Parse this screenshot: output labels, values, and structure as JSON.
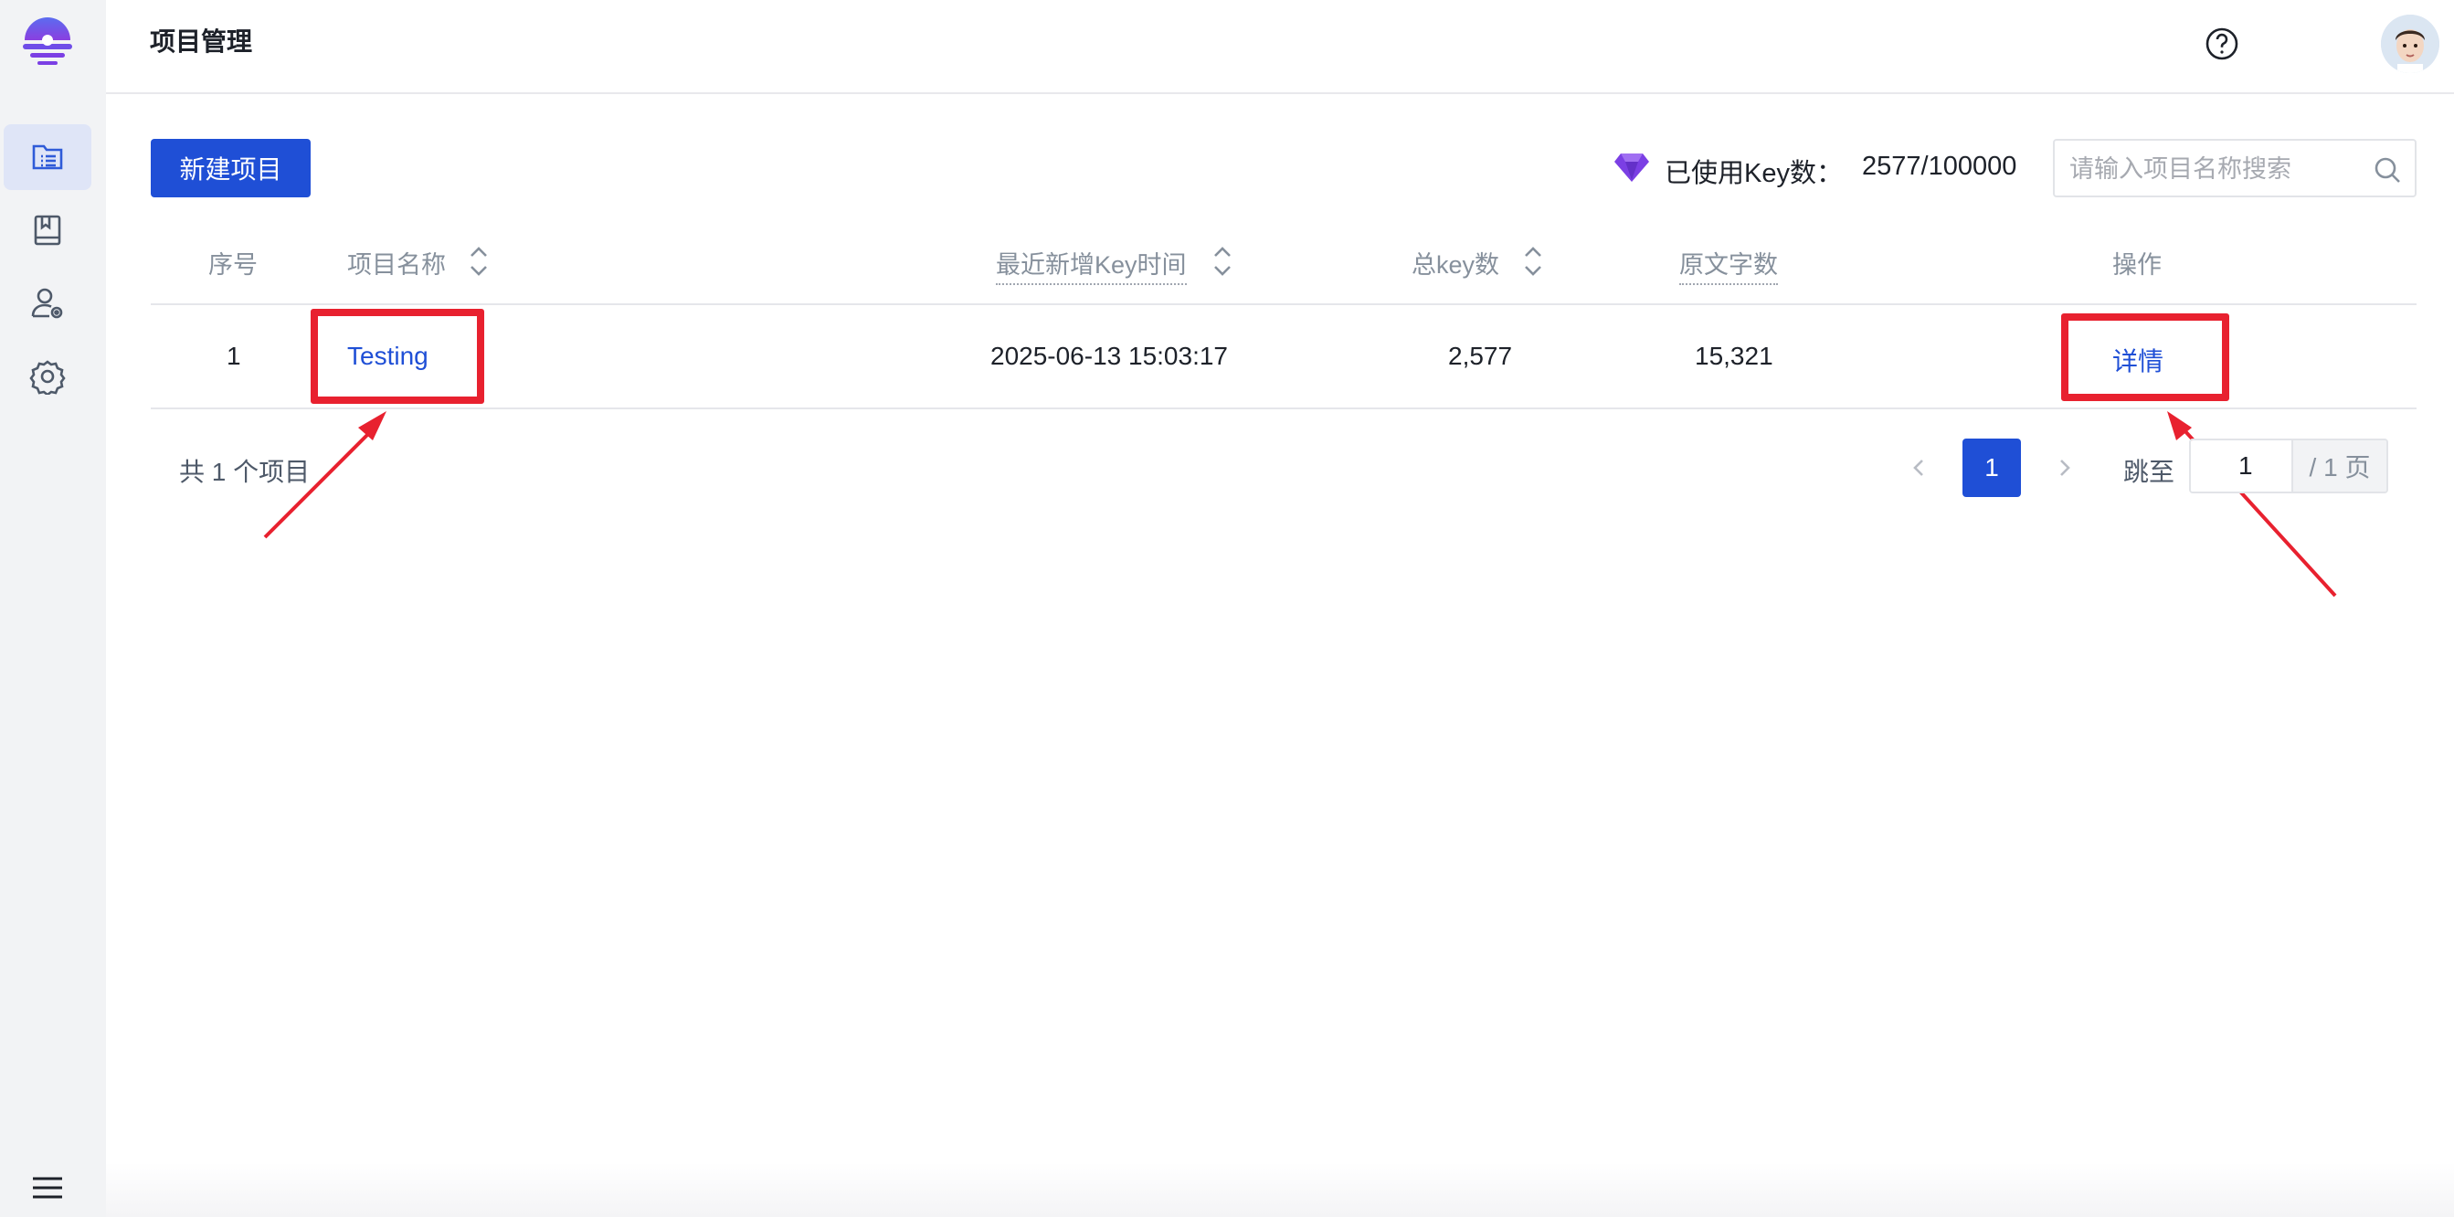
{
  "header": {
    "title": "项目管理"
  },
  "toolbar": {
    "new_project_label": "新建项目",
    "key_usage_label": "已使用Key数：",
    "key_usage_value": "2577/100000",
    "search_placeholder": "请输入项目名称搜索"
  },
  "sidebar": {
    "items": [
      {
        "icon": "project-list-icon",
        "active": true
      },
      {
        "icon": "book-icon",
        "active": false
      },
      {
        "icon": "user-settings-icon",
        "active": false
      },
      {
        "icon": "gear-icon",
        "active": false
      }
    ],
    "bottom_icon": "hamburger-menu-icon"
  },
  "table": {
    "columns": [
      "序号",
      "项目名称",
      "最近新增Key时间",
      "总key数",
      "原文字数",
      "操作"
    ],
    "rows": [
      {
        "index": "1",
        "name": "Testing",
        "last_key_time": "2025-06-13 15:03:17",
        "total_keys": "2,577",
        "source_chars": "15,321",
        "action": "详情"
      }
    ]
  },
  "pagination": {
    "total_text": "共 1 个项目",
    "current_page": "1",
    "jump_label": "跳至",
    "jump_value": "1",
    "jump_suffix": "/ 1 页"
  },
  "colors": {
    "primary": "#1f4fd6",
    "annotation_red": "#e8212f",
    "brand_purple": "#7b3fe4"
  }
}
